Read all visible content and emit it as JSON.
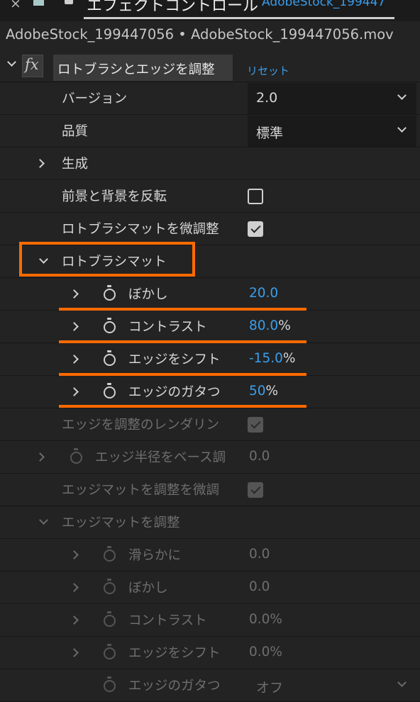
{
  "panel": {
    "close_glyph": "×",
    "title": "エフェクトコントロール",
    "title_file": "AdobeStock_199447",
    "breadcrumb": "AdobeStock_199447056 • AdobeStock_199447056.mov"
  },
  "effect": {
    "fx_label": "fx",
    "name": "ロトブラシとエッジを調整",
    "reset": "リセット"
  },
  "rows": {
    "version": {
      "label": "バージョン",
      "value": "2.0"
    },
    "quality": {
      "label": "品質",
      "value": "標準"
    },
    "generate": {
      "label": "生成"
    },
    "invert": {
      "label": "前景と背景を反転",
      "checked": false
    },
    "refine_roto": {
      "label": "ロトブラシマットを微調整",
      "checked": true
    },
    "roto_matte": {
      "label": "ロトブラシマット"
    },
    "feather": {
      "label": "ぼかし",
      "value": "20.0"
    },
    "contrast": {
      "label": "コントラスト",
      "value": "80.0",
      "unit": "%"
    },
    "shift_edge": {
      "label": "エッジをシフト",
      "value": "-15.0",
      "unit": "%"
    },
    "chatter": {
      "label": "エッジのガタつ",
      "value": "50",
      "unit": "%"
    },
    "render_refine": {
      "label": "エッジを調整のレンダリン",
      "checked": true
    },
    "base_radius": {
      "label": "エッジ半径をベース調",
      "value": "0.0"
    },
    "refine_edge_matte": {
      "label": "エッジマットを調整を微調",
      "checked": true
    },
    "edge_matte": {
      "label": "エッジマットを調整"
    },
    "smooth2": {
      "label": "滑らかに",
      "value": "0.0"
    },
    "feather2": {
      "label": "ぼかし",
      "value": "0.0"
    },
    "contrast2": {
      "label": "コントラスト",
      "value": "0.0%"
    },
    "shift2": {
      "label": "エッジをシフト",
      "value": "0.0%"
    },
    "chatter2": {
      "label": "エッジのガタつ",
      "value": "オフ"
    }
  },
  "colors": {
    "accent": "#3b9eea",
    "highlight": "#ff6a00",
    "bg": "#232323"
  }
}
